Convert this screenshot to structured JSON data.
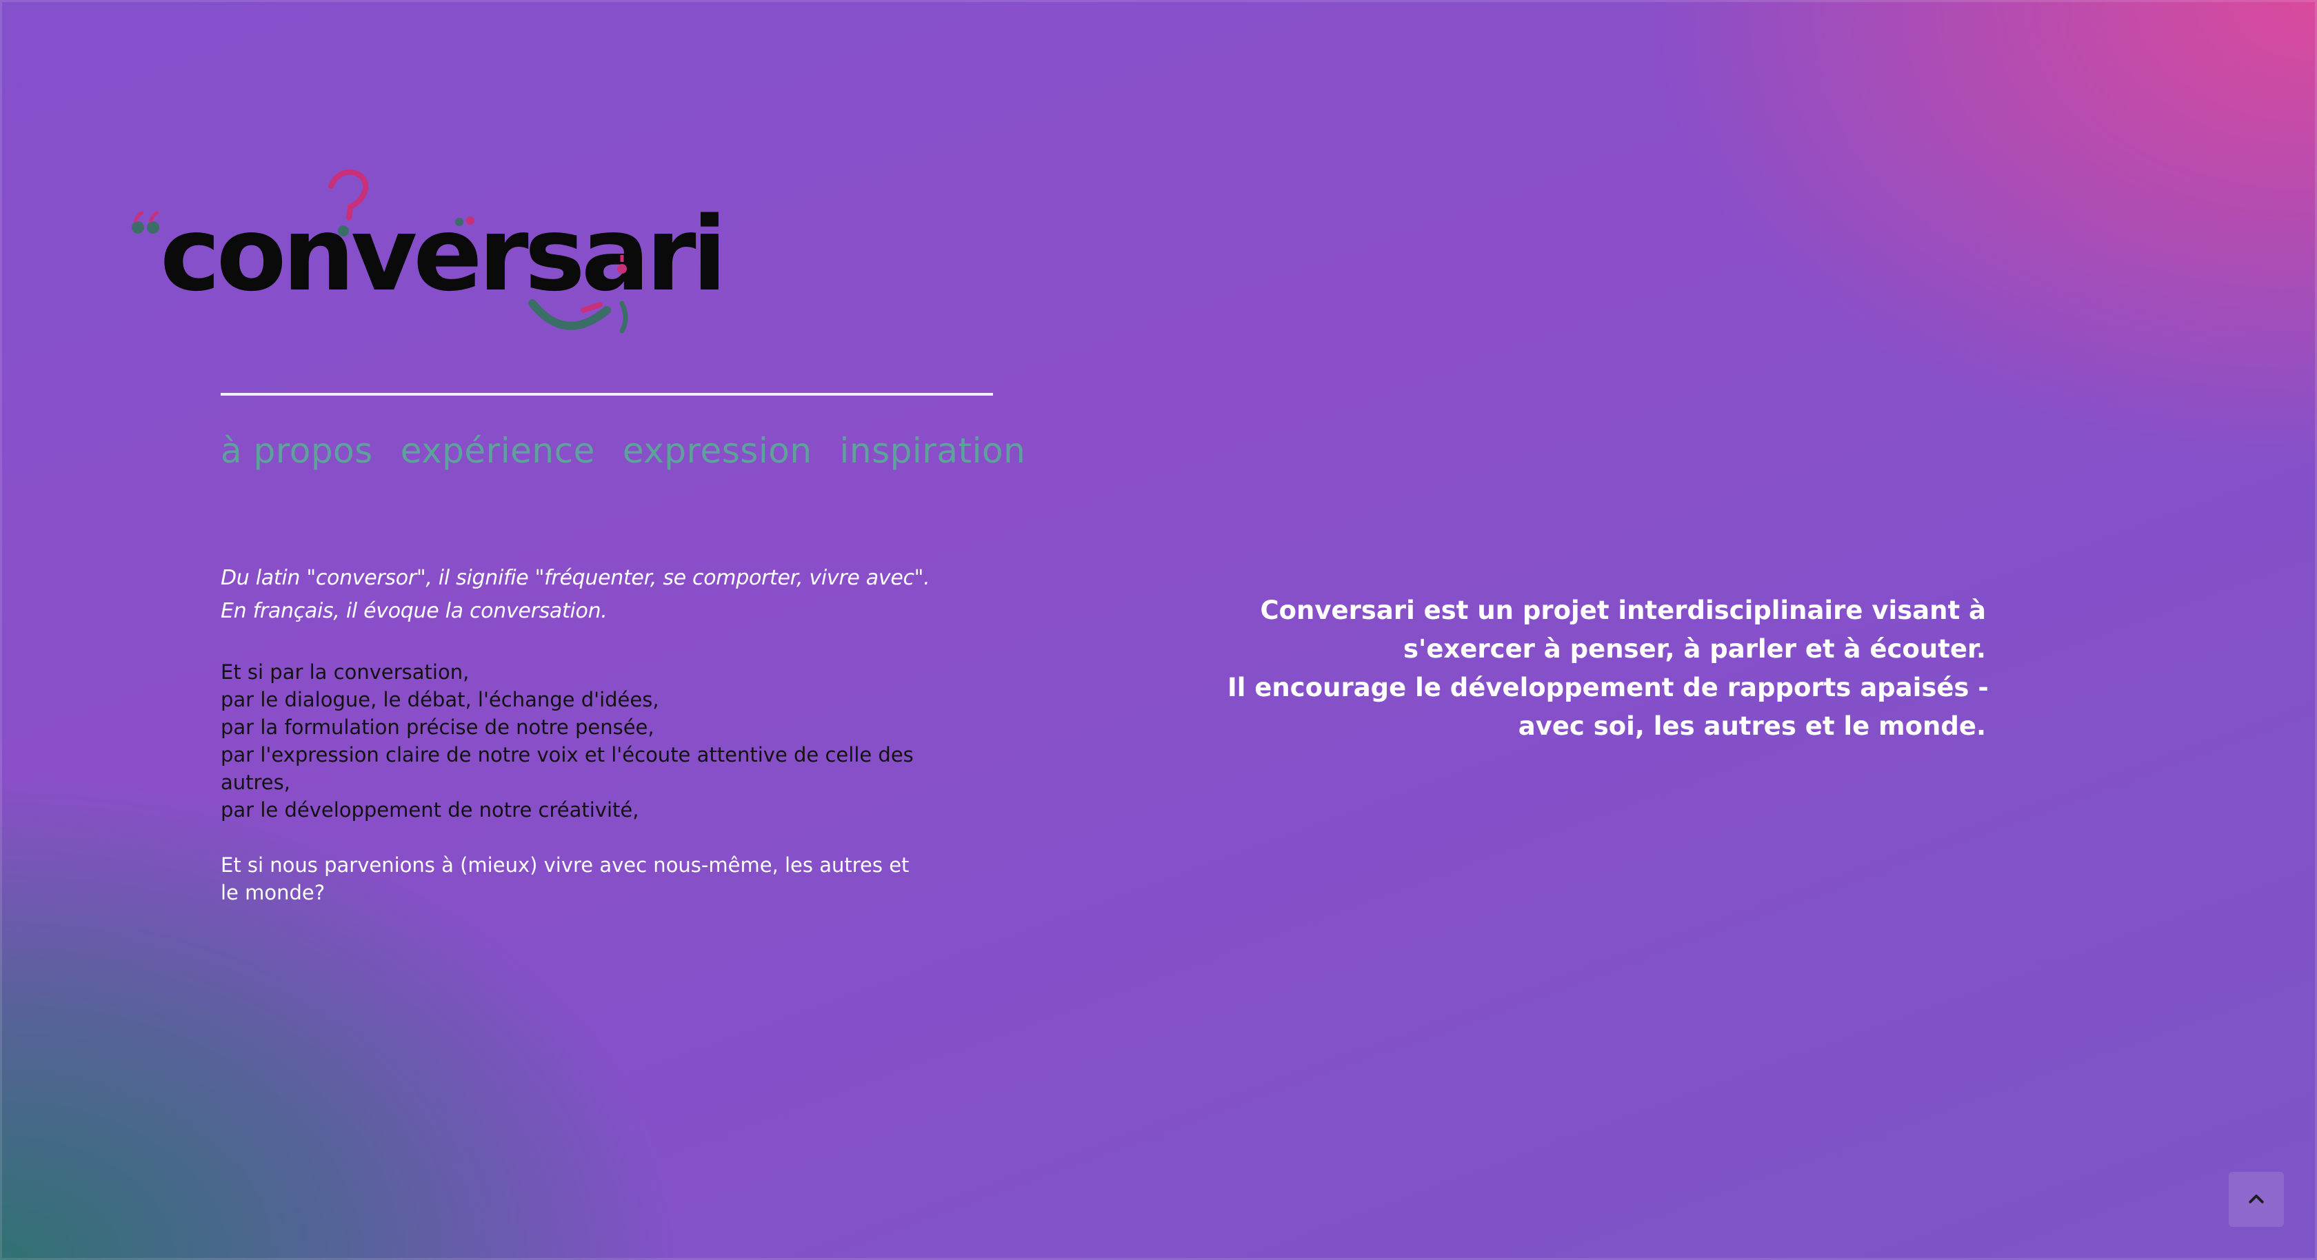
{
  "logo": {
    "text": "conversari"
  },
  "nav": {
    "items": [
      {
        "label": "à propos"
      },
      {
        "label": "expérience"
      },
      {
        "label": "expression"
      },
      {
        "label": "inspiration"
      }
    ]
  },
  "intro": {
    "line1": "Du latin \"conversor\", il signifie \"fréquenter, se comporter, vivre avec\".",
    "line2": "En français, il évoque la conversation."
  },
  "body": {
    "lines": [
      "Et si par la conversation,",
      "par le dialogue, le débat, l'échange d'idées,",
      "par la formulation précise de notre pensée,",
      "par l'expression claire de notre voix et l'écoute attentive de celle des autres,",
      "par le développement de notre créativité,"
    ],
    "closing": "Et si nous parvenions à (mieux) vivre avec nous-même, les autres et le monde?"
  },
  "tagline": {
    "line1": "Conversari est un projet interdisciplinaire visant à",
    "line2": "s'exercer à penser, à parler et à écouter.",
    "line3": "Il encourage le développement de rapports apaisés -",
    "line4": "avec soi, les autres et le monde."
  },
  "scroll_top": {
    "icon": "chevron-up-icon"
  },
  "colors": {
    "nav_link": "#5ea39b",
    "logo_text": "#0a0a0a",
    "logo_pink": "#c8307a",
    "logo_teal": "#3c6e68",
    "gradient_purple": "#8450cb",
    "gradient_pink": "#de4a9a",
    "gradient_teal": "#2c736e"
  }
}
